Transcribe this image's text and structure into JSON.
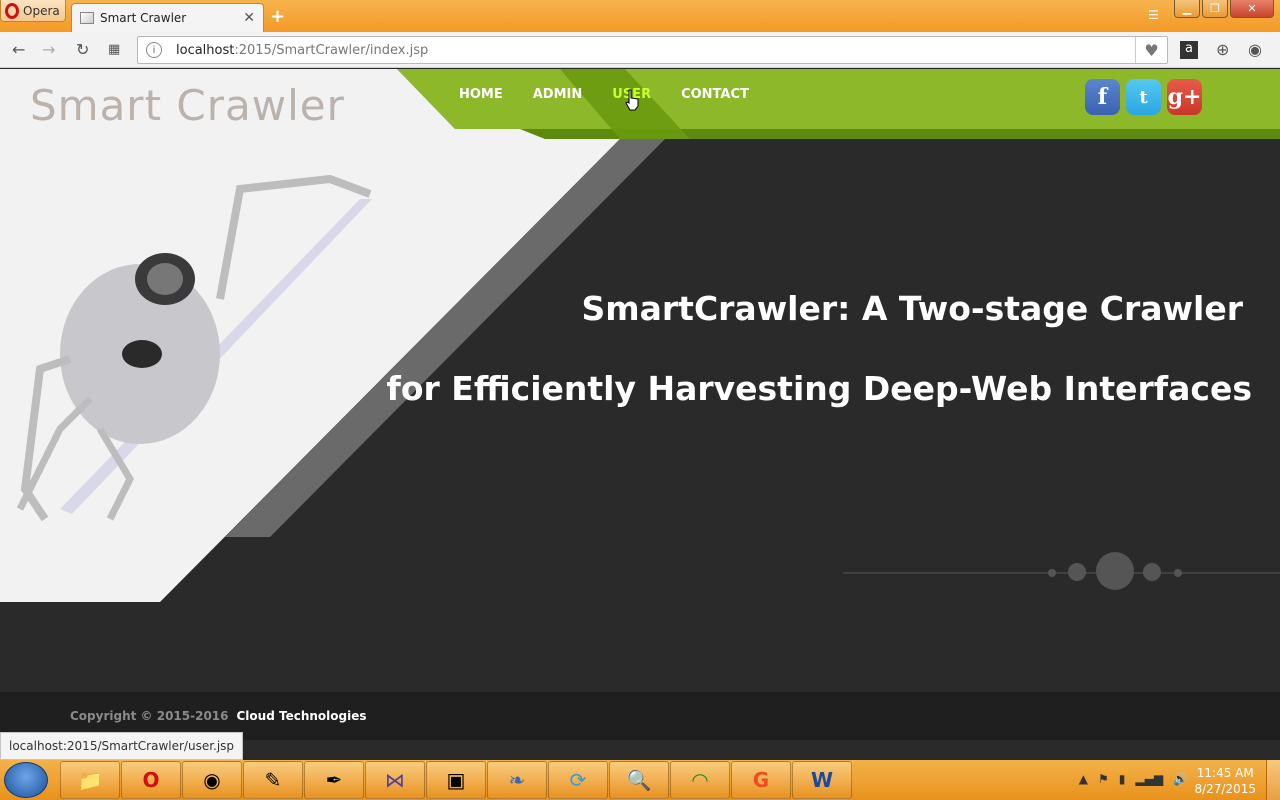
{
  "browser": {
    "app_button": "Opera",
    "tab_title": "Smart Crawler",
    "url_host": "localhost",
    "url_rest": ":2015/SmartCrawler/index.jsp",
    "status_url": "localhost:2015/SmartCrawler/user.jsp"
  },
  "site": {
    "logo": "Smart Crawler",
    "nav": [
      "HOME",
      "ADMIN",
      "USER",
      "CONTACT"
    ],
    "active_nav": "USER",
    "socials": {
      "facebook": "f",
      "twitter": "t",
      "google": "g+"
    },
    "headline_line1": "SmartCrawler: A Two-stage Crawler",
    "headline_line2": "for Efficiently Harvesting Deep-Web Interfaces",
    "footer_copyright": "Copyright © 2015-2016",
    "footer_org": "Cloud Technologies"
  },
  "taskbar": {
    "time": "11:45 AM",
    "date": "8/27/2015"
  },
  "colors": {
    "nav_green": "#8db82a",
    "nav_dark_green": "#5d8a0e",
    "active_link": "#c8ff30",
    "page_bg": "#2a2a2a"
  }
}
